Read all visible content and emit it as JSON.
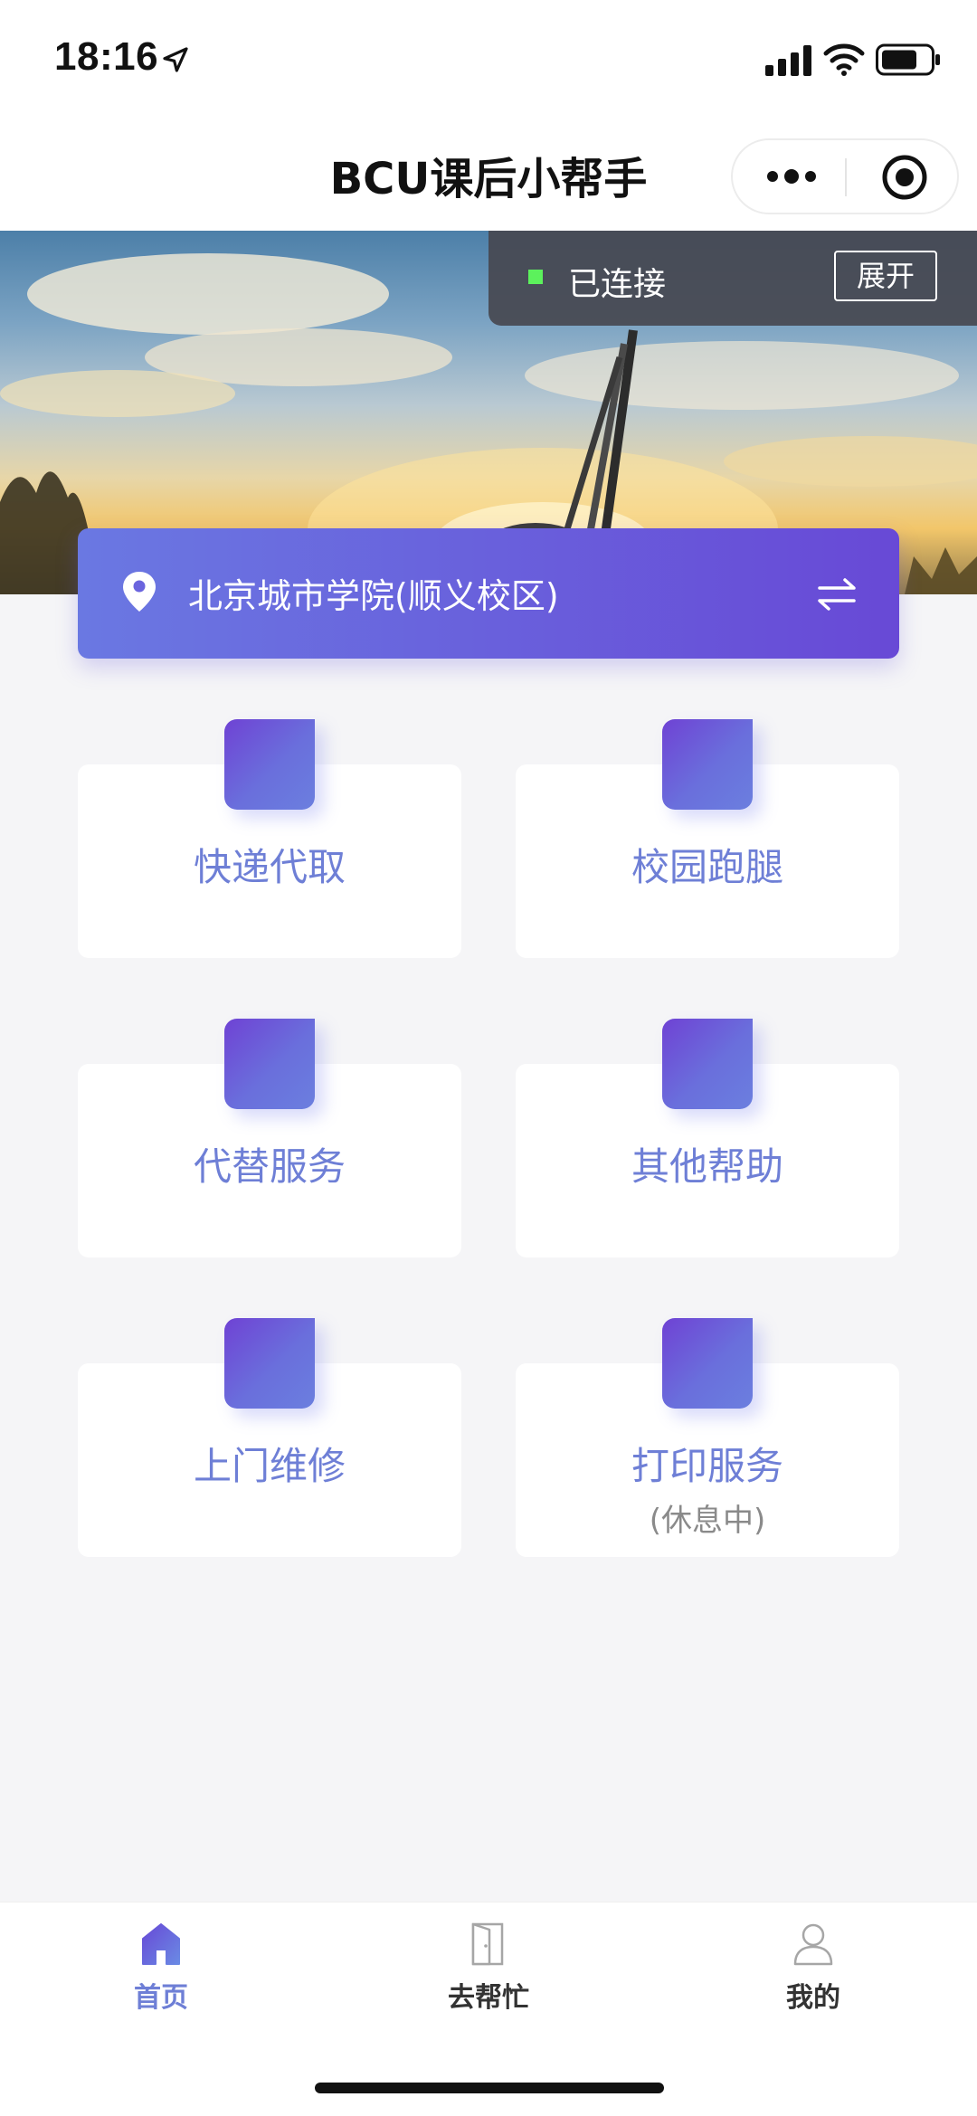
{
  "status_bar": {
    "time": "18:16"
  },
  "nav": {
    "title": "BCU课后小帮手"
  },
  "connection": {
    "status": "已连接",
    "expand_label": "展开",
    "indicator_color": "#5cf15c"
  },
  "campus": {
    "name": "北京城市学院(顺义校区)"
  },
  "services": [
    {
      "label": "快递代取"
    },
    {
      "label": "校园跑腿"
    },
    {
      "label": "代替服务"
    },
    {
      "label": "其他帮助"
    },
    {
      "label": "上门维修"
    },
    {
      "label": "打印服务",
      "sub": "(休息中)"
    }
  ],
  "tabs": [
    {
      "label": "首页",
      "icon": "home-icon",
      "active": true
    },
    {
      "label": "去帮忙",
      "icon": "door-icon",
      "active": false
    },
    {
      "label": "我的",
      "icon": "user-icon",
      "active": false
    }
  ],
  "colors": {
    "accent": "#6e7fd6",
    "gradient_start": "#6a78e2",
    "gradient_end": "#6849d6",
    "background": "#f5f5f7"
  }
}
